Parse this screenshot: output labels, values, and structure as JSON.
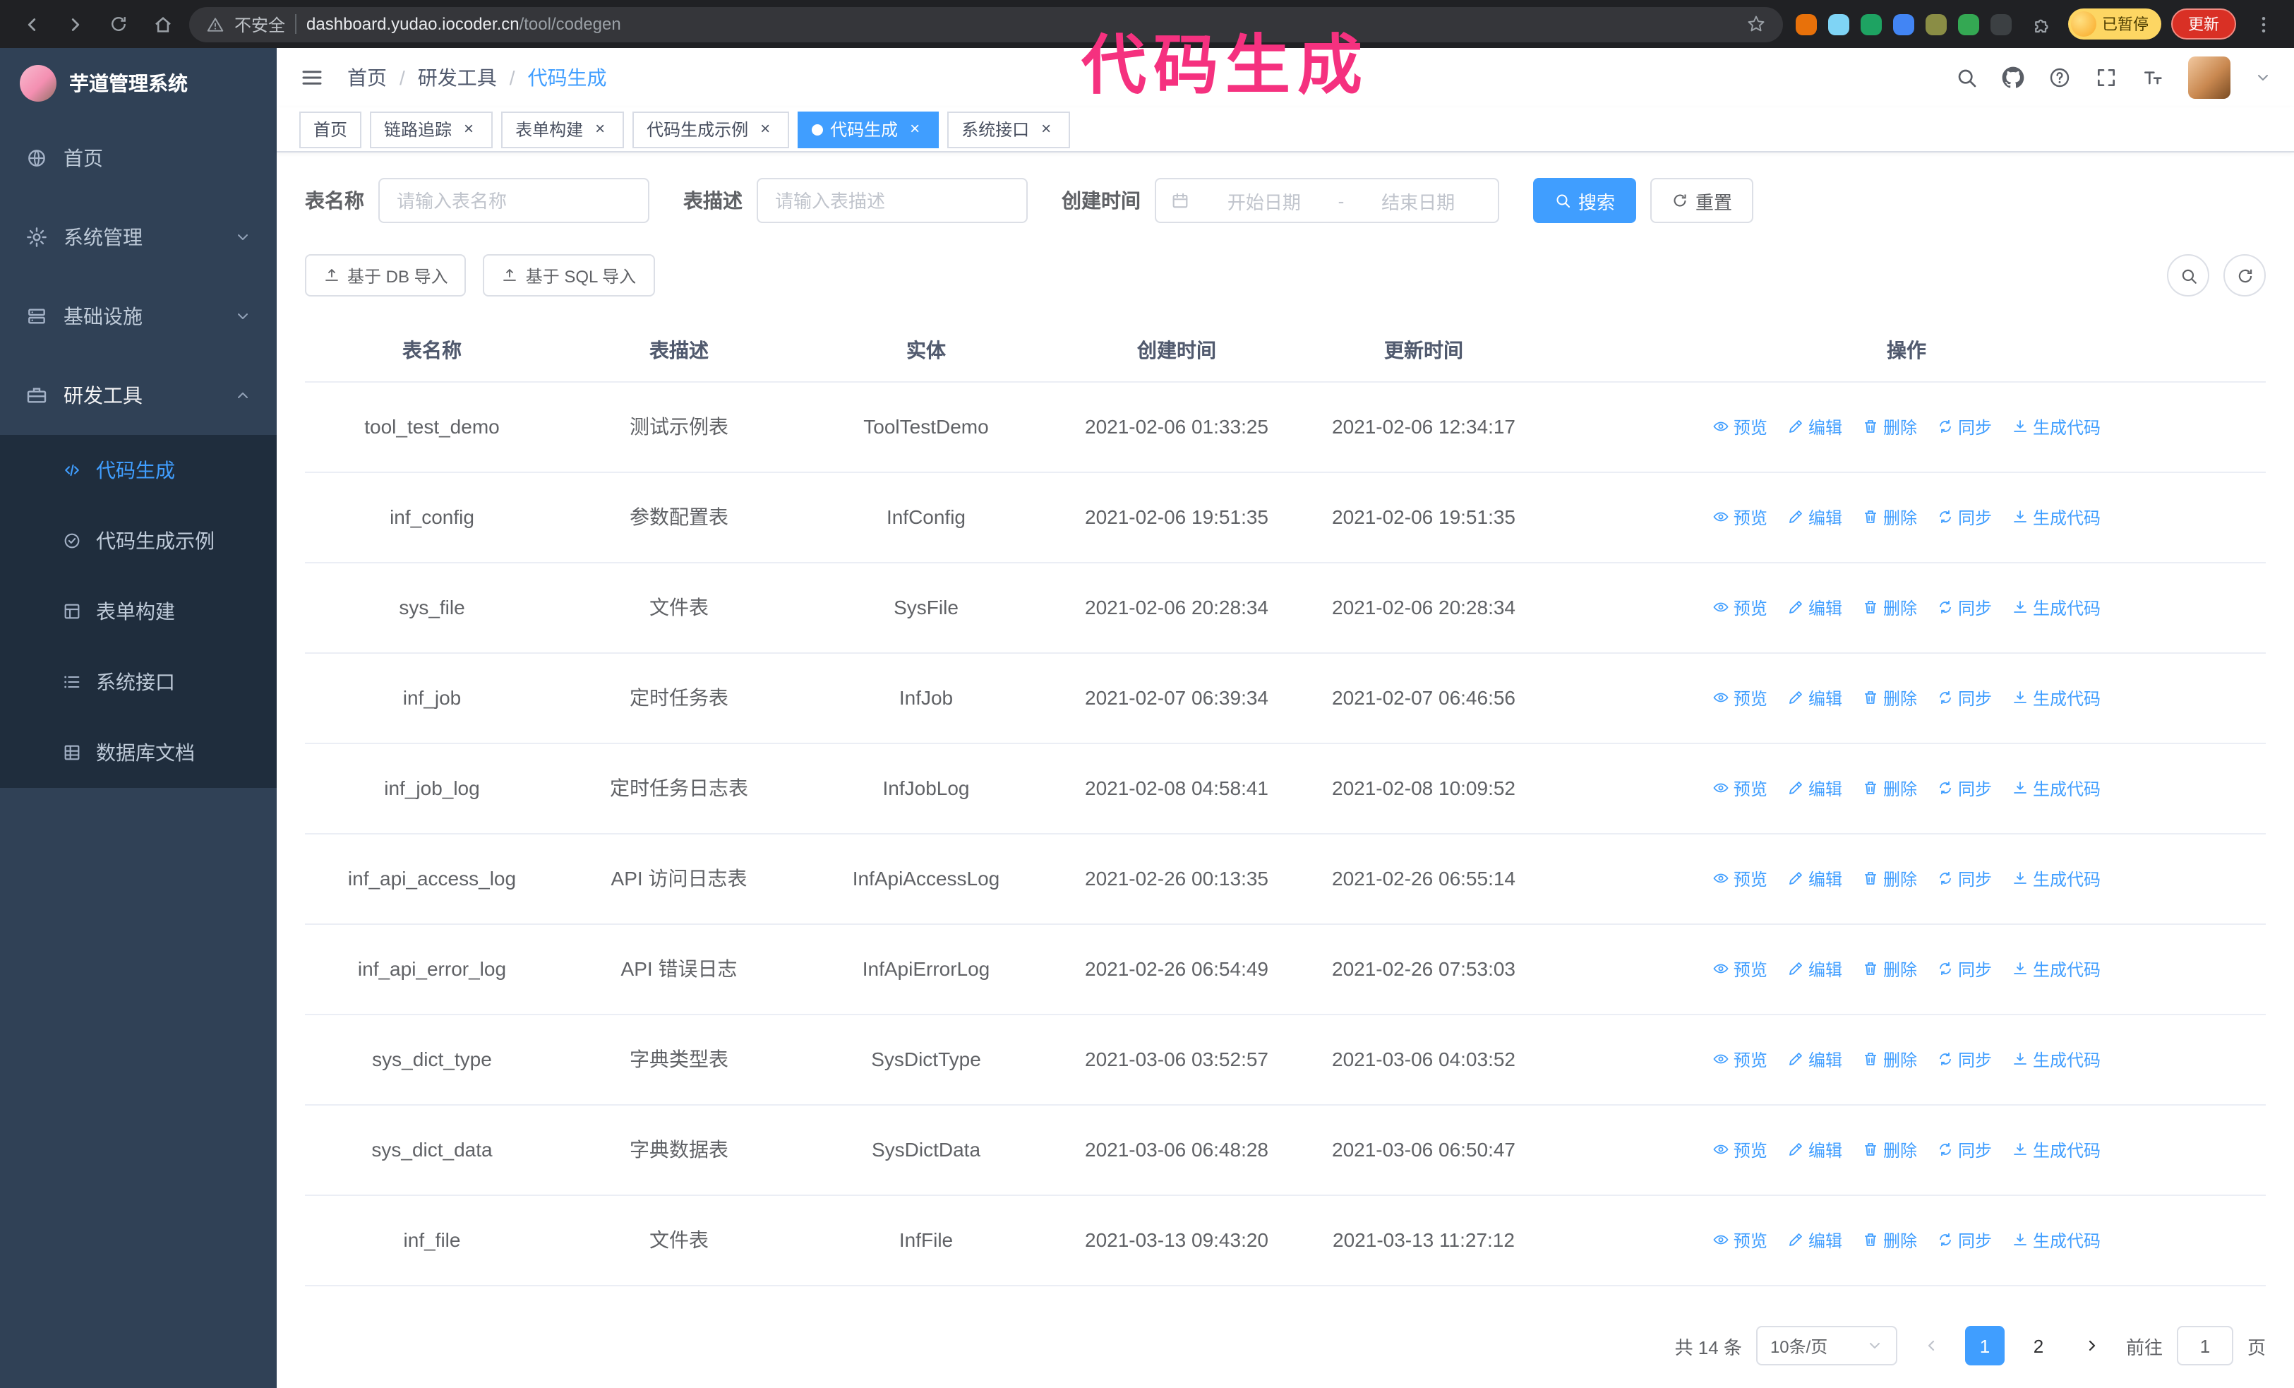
{
  "colors": {
    "accent": "#409eff",
    "sidebar_bg": "#304156",
    "submenu_bg": "#1f2d3d",
    "annotation": "#f5317f",
    "table_border": "#ebeef5",
    "tab_border": "#d8dce5"
  },
  "browser": {
    "security_label": "不安全",
    "url_domain": "dashboard.yudao.iocoder.cn",
    "url_path": "/tool/codegen",
    "paused_badge": "已暂停",
    "update_button": "更新",
    "extension_colors": [
      "#e8710a",
      "#7fd4f5",
      "#1ea362",
      "#4285f4",
      "#8a8d45",
      "#34a853",
      "#3c4043"
    ]
  },
  "annotation": "代码生成",
  "sidebar": {
    "logo_title": "芋道管理系统",
    "items": [
      {
        "label": "首页"
      },
      {
        "label": "系统管理"
      },
      {
        "label": "基础设施"
      },
      {
        "label": "研发工具"
      }
    ],
    "sub_items": [
      {
        "label": "代码生成",
        "active": true
      },
      {
        "label": "代码生成示例"
      },
      {
        "label": "表单构建"
      },
      {
        "label": "系统接口"
      },
      {
        "label": "数据库文档"
      }
    ]
  },
  "header": {
    "breadcrumb": [
      "首页",
      "研发工具",
      "代码生成"
    ]
  },
  "tabs": [
    {
      "label": "首页",
      "closable": false,
      "active": false
    },
    {
      "label": "链路追踪",
      "closable": true,
      "active": false
    },
    {
      "label": "表单构建",
      "closable": true,
      "active": false
    },
    {
      "label": "代码生成示例",
      "closable": true,
      "active": false
    },
    {
      "label": "代码生成",
      "closable": true,
      "active": true
    },
    {
      "label": "系统接口",
      "closable": true,
      "active": false
    }
  ],
  "filters": {
    "table_name_label": "表名称",
    "table_name_placeholder": "请输入表名称",
    "table_desc_label": "表描述",
    "table_desc_placeholder": "请输入表描述",
    "create_time_label": "创建时间",
    "date_start_placeholder": "开始日期",
    "date_separator": "-",
    "date_end_placeholder": "结束日期",
    "search_label": "搜索",
    "reset_label": "重置"
  },
  "toolbar": {
    "db_import_label": "基于 DB 导入",
    "sql_import_label": "基于 SQL 导入"
  },
  "table": {
    "columns": [
      "表名称",
      "表描述",
      "实体",
      "创建时间",
      "更新时间",
      "操作"
    ],
    "actions": [
      {
        "label": "预览",
        "icon": "eye-icon",
        "name": "preview-action"
      },
      {
        "label": "编辑",
        "icon": "edit-icon",
        "name": "edit-action"
      },
      {
        "label": "删除",
        "icon": "trash-icon",
        "name": "delete-action"
      },
      {
        "label": "同步",
        "icon": "sync-icon",
        "name": "sync-action"
      },
      {
        "label": "生成代码",
        "icon": "download-icon",
        "name": "generate-code-action"
      }
    ],
    "rows": [
      {
        "name": "tool_test_demo",
        "desc": "测试示例表",
        "entity": "ToolTestDemo",
        "created": "2021-02-06 01:33:25",
        "updated": "2021-02-06 12:34:17"
      },
      {
        "name": "inf_config",
        "desc": "参数配置表",
        "entity": "InfConfig",
        "created": "2021-02-06 19:51:35",
        "updated": "2021-02-06 19:51:35"
      },
      {
        "name": "sys_file",
        "desc": "文件表",
        "entity": "SysFile",
        "created": "2021-02-06 20:28:34",
        "updated": "2021-02-06 20:28:34"
      },
      {
        "name": "inf_job",
        "desc": "定时任务表",
        "entity": "InfJob",
        "created": "2021-02-07 06:39:34",
        "updated": "2021-02-07 06:46:56"
      },
      {
        "name": "inf_job_log",
        "desc": "定时任务日志表",
        "entity": "InfJobLog",
        "created": "2021-02-08 04:58:41",
        "updated": "2021-02-08 10:09:52"
      },
      {
        "name": "inf_api_access_log",
        "desc": "API 访问日志表",
        "entity": "InfApiAccessLog",
        "created": "2021-02-26 00:13:35",
        "updated": "2021-02-26 06:55:14"
      },
      {
        "name": "inf_api_error_log",
        "desc": "API 错误日志",
        "entity": "InfApiErrorLog",
        "created": "2021-02-26 06:54:49",
        "updated": "2021-02-26 07:53:03"
      },
      {
        "name": "sys_dict_type",
        "desc": "字典类型表",
        "entity": "SysDictType",
        "created": "2021-03-06 03:52:57",
        "updated": "2021-03-06 04:03:52"
      },
      {
        "name": "sys_dict_data",
        "desc": "字典数据表",
        "entity": "SysDictData",
        "created": "2021-03-06 06:48:28",
        "updated": "2021-03-06 06:50:47"
      },
      {
        "name": "inf_file",
        "desc": "文件表",
        "entity": "InfFile",
        "created": "2021-03-13 09:43:20",
        "updated": "2021-03-13 11:27:12"
      }
    ]
  },
  "pagination": {
    "total": "共 14 条",
    "page_size": "10条/页",
    "pages": [
      "1",
      "2"
    ],
    "goto_label": "前往",
    "goto_value": "1",
    "page_suffix": "页"
  }
}
